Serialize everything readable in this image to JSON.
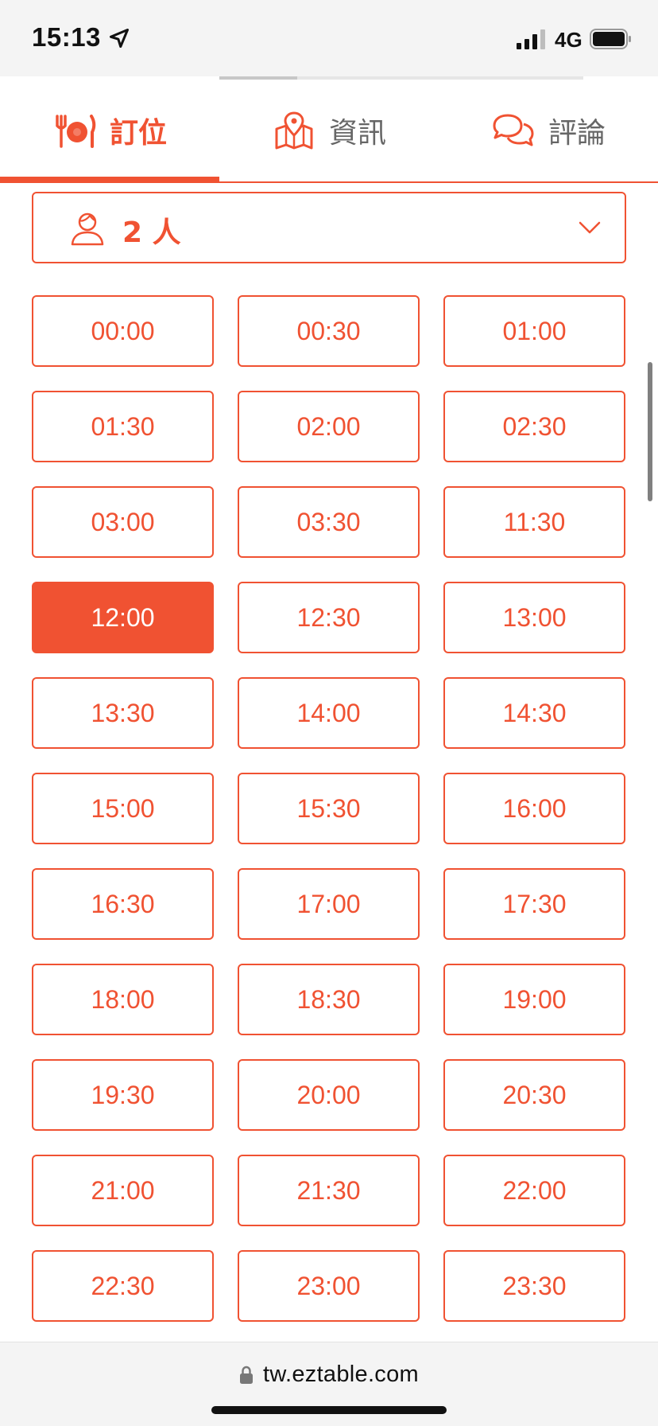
{
  "status_bar": {
    "time": "15:13",
    "network": "4G",
    "location_icon": "location-arrow-icon",
    "signal_icon": "cellular-signal-icon",
    "battery_icon": "battery-icon"
  },
  "tabs": [
    {
      "label": "訂位",
      "icon": "dining-icon",
      "active": true
    },
    {
      "label": "資訊",
      "icon": "map-pin-icon",
      "active": false
    },
    {
      "label": "評論",
      "icon": "chat-bubbles-icon",
      "active": false
    }
  ],
  "party_size": {
    "label": "2 人",
    "icon": "person-icon",
    "dropdown_icon": "chevron-down-icon"
  },
  "time_slots": [
    "00:00",
    "00:30",
    "01:00",
    "01:30",
    "02:00",
    "02:30",
    "03:00",
    "03:30",
    "11:30",
    "12:00",
    "12:30",
    "13:00",
    "13:30",
    "14:00",
    "14:30",
    "15:00",
    "15:30",
    "16:00",
    "16:30",
    "17:00",
    "17:30",
    "18:00",
    "18:30",
    "19:00",
    "19:30",
    "20:00",
    "20:30",
    "21:00",
    "21:30",
    "22:00",
    "22:30",
    "23:00",
    "23:30"
  ],
  "selected_time": "12:00",
  "browser": {
    "url": "tw.eztable.com",
    "lock_icon": "lock-icon"
  },
  "colors": {
    "accent": "#f05232",
    "inactive_tab": "#666666"
  }
}
